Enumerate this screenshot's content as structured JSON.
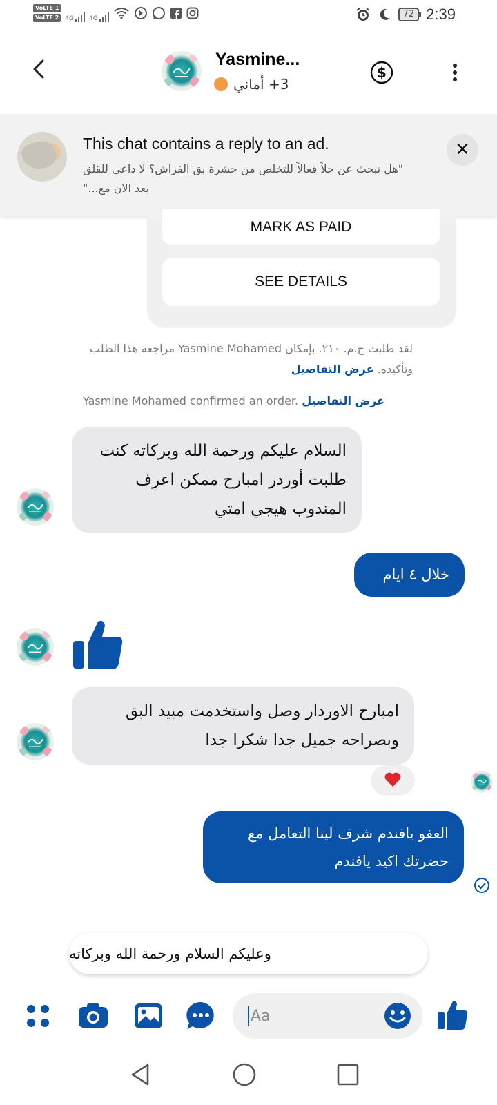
{
  "status_bar": {
    "volte_1": "VoLTE 1",
    "volte_2": "VoLTE 2",
    "net_1": "4G",
    "net_2": "4G",
    "battery": "72",
    "time": "2:39"
  },
  "header": {
    "name": "Yasmine...",
    "subtitle": "3+ أماني",
    "status_color": "#f29b43"
  },
  "ad_banner": {
    "title": "This chat contains a reply to an ad.",
    "description": "\"هل تبحث عن حلاً فعالاً للتخلص من حشرة بق الفراش؟ لا داعي للقلق بعد الان مع...\""
  },
  "order_card": {
    "mark_paid": "MARK AS PAID",
    "see_details": "SEE DETAILS"
  },
  "system_messages": {
    "order_request": "لقد طلبت ج.م. ٢١٠. بإمكان Yasmine Mohamed مراجعة هذا الطلب وتأكيده.",
    "order_request_link": "عرض التفاصيل",
    "confirmed": "Yasmine Mohamed confirmed an order.",
    "confirmed_link": "عرض التفاصيل"
  },
  "messages": [
    {
      "direction": "in",
      "text": "السلام عليكم ورحمة الله وبركاته كنت طلبت أوردر امبارح ممكن اعرف المندوب هيجي امتي"
    },
    {
      "direction": "out",
      "text": "خلال ٤ ايام"
    },
    {
      "direction": "in",
      "type": "like"
    },
    {
      "direction": "in",
      "text": "امبارح الاوردار وصل واستخدمت مبيد البق وبصراحه جميل جدا  شكرا جدا",
      "reaction": "heart"
    },
    {
      "direction": "out",
      "text": "العفو يافندم شرف لينا التعامل مع حضرتك اكيد يافندم",
      "status": "sent"
    }
  ],
  "quick_reply": "وعليكم السلام ورحمة الله وبركاته",
  "composer": {
    "placeholder": "Aa",
    "accent": "#0a53a8"
  },
  "colors": {
    "brand_blue": "#0a53a8",
    "incoming_bubble": "#e9e9eb",
    "banner_bg": "#f2f2f2"
  }
}
